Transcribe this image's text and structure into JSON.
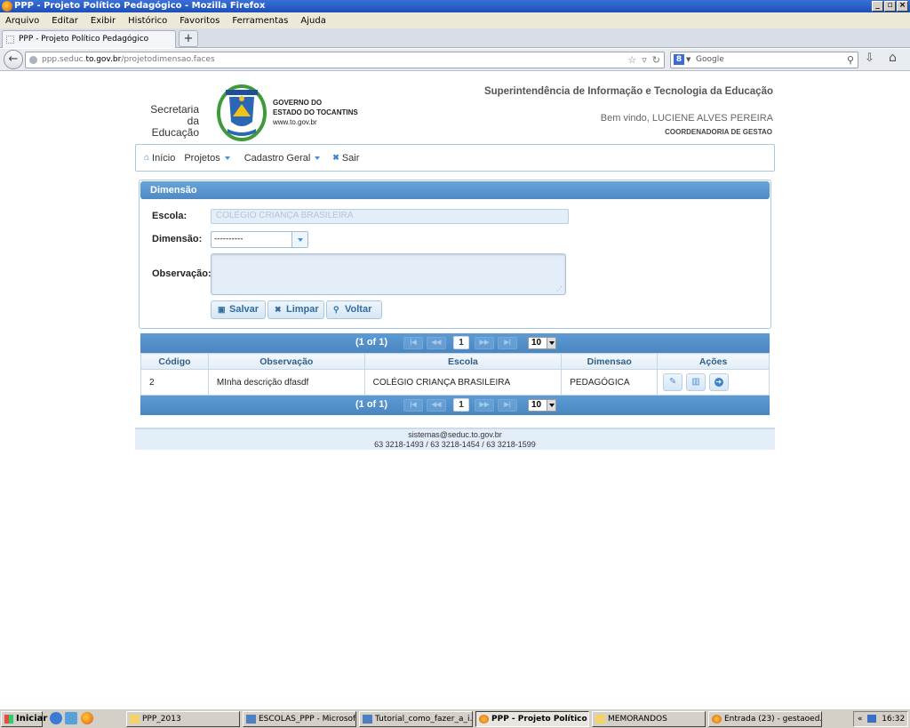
{
  "window": {
    "title": "PPP - Projeto Político Pedagógico - Mozilla Firefox"
  },
  "menu": {
    "items": [
      "Arquivo",
      "Editar",
      "Exibir",
      "Histórico",
      "Favoritos",
      "Ferramentas",
      "Ajuda"
    ]
  },
  "tab": {
    "title": "PPP - Projeto Político Pedagógico",
    "new_tab": "+"
  },
  "nav": {
    "url_prefix": "ppp.seduc.",
    "url_domain": "to.gov.br",
    "url_path": "/projetodimensao.faces",
    "search_placeholder": "Google",
    "search_engine_letter": "8"
  },
  "header": {
    "secretaria": "Secretaria da Educação",
    "gov_line1": "GOVERNO DO",
    "gov_line2": "ESTADO DO TOCANTINS",
    "gov_site": "www.to.gov.br",
    "super_title": "Superintendência de Informação e Tecnologia da Educação",
    "welcome": "Bem vindo, LUCIENE ALVES PEREIRA",
    "coordinator": "COORDENADORIA DE GESTAO"
  },
  "topmenu": {
    "inicio": "Início",
    "projetos": "Projetos",
    "cadastro": "Cadastro Geral",
    "sair": "Sair"
  },
  "form": {
    "panel_title": "Dimensão",
    "escola_label": "Escola:",
    "escola_value": "COLÉGIO CRIANÇA BRASILEIRA",
    "dimensao_label": "Dimensão:",
    "dimensao_value": "----------",
    "observacao_label": "Observação:",
    "btn_salvar": "Salvar",
    "btn_limpar": "Limpar",
    "btn_voltar": "Voltar"
  },
  "table": {
    "pager_info": "(1 of 1)",
    "current_page": "1",
    "rows_per_page": "10",
    "columns": [
      "Código",
      "Observação",
      "Escola",
      "Dimensao",
      "Ações"
    ],
    "rows": [
      {
        "codigo": "2",
        "observacao": "MInha descrição dfasdf",
        "escola": "COLÉGIO CRIANÇA BRASILEIRA",
        "dimensao": "PEDAGÓGICA"
      }
    ]
  },
  "footer": {
    "email": "sistemas@seduc.to.gov.br",
    "phones": "63 3218-1493 / 63 3218-1454 / 63 3218-1599"
  },
  "taskbar": {
    "start": "Iniciar",
    "tasks": [
      "PPP_2013",
      "ESCOLAS_PPP - Microsof...",
      "Tutorial_como_fazer_a_i...",
      "PPP - Projeto Político ...",
      "MEMORANDOS",
      "Entrada (23) - gestaoed..."
    ],
    "clock": "16:32",
    "tray_chevron": "«"
  }
}
